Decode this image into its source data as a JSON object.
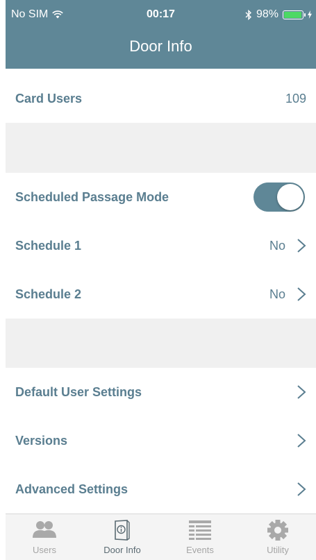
{
  "status": {
    "carrier": "No SIM",
    "time": "00:17",
    "battery_percent": "98%",
    "battery_level": 0.98
  },
  "nav": {
    "title": "Door Info"
  },
  "rows": {
    "card_users": {
      "label": "Card Users",
      "value": "109"
    },
    "scheduled_passage": {
      "label": "Scheduled Passage Mode",
      "toggle_on": true
    },
    "schedule1": {
      "label": "Schedule 1",
      "value": "No"
    },
    "schedule2": {
      "label": "Schedule 2",
      "value": "No"
    },
    "default_user": {
      "label": "Default User Settings"
    },
    "versions": {
      "label": "Versions"
    },
    "advanced": {
      "label": "Advanced Settings"
    }
  },
  "tabs": [
    {
      "label": "Users",
      "icon": "users-icon"
    },
    {
      "label": "Door Info",
      "icon": "door-info-icon",
      "active": true
    },
    {
      "label": "Events",
      "icon": "events-icon"
    },
    {
      "label": "Utility",
      "icon": "gear-icon"
    }
  ],
  "colors": {
    "header": "#5f8797",
    "label": "#5a7e90",
    "separator": "#f0f0f0",
    "battery_fill": "#4cd964"
  }
}
